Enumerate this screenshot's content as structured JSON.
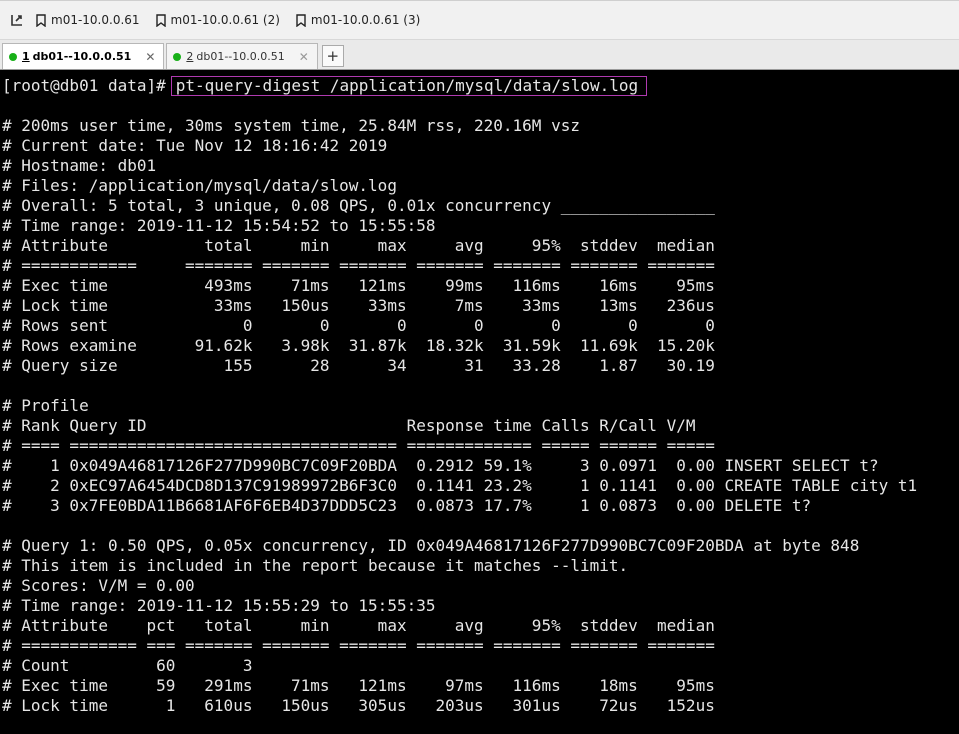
{
  "bookmarks": [
    "m01-10.0.0.61",
    "m01-10.0.0.61 (2)",
    "m01-10.0.0.61 (3)"
  ],
  "tabs": [
    {
      "num": "1",
      "label": "db01--10.0.0.51",
      "active": true
    },
    {
      "num": "2",
      "label": "db01--10.0.0.51",
      "active": false
    }
  ],
  "new_tab_label": "+",
  "terminal": {
    "prompt": "[root@db01 data]#",
    "command": "pt-query-digest /application/mysql/data/slow.log",
    "lines": [
      "",
      "# 200ms user time, 30ms system time, 25.84M rss, 220.16M vsz",
      "# Current date: Tue Nov 12 18:16:42 2019",
      "# Hostname: db01",
      "# Files: /application/mysql/data/slow.log",
      "# Overall: 5 total, 3 unique, 0.08 QPS, 0.01x concurrency ________________",
      "# Time range: 2019-11-12 15:54:52 to 15:55:58",
      "# Attribute          total     min     max     avg     95%  stddev  median",
      "# ============     ======= ======= ======= ======= ======= ======= =======",
      "# Exec time          493ms    71ms   121ms    99ms   116ms    16ms    95ms",
      "# Lock time           33ms   150us    33ms     7ms    33ms    13ms   236us",
      "# Rows sent              0       0       0       0       0       0       0",
      "# Rows examine      91.62k   3.98k  31.87k  18.32k  31.59k  11.69k  15.20k",
      "# Query size           155      28      34      31   33.28    1.87   30.19",
      "",
      "# Profile",
      "# Rank Query ID                           Response time Calls R/Call V/M",
      "# ==== ================================== ============= ===== ====== =====",
      "#    1 0x049A46817126F277D990BC7C09F20BDA  0.2912 59.1%     3 0.0971  0.00 INSERT SELECT t?",
      "#    2 0xEC97A6454DCD8D137C91989972B6F3C0  0.1141 23.2%     1 0.1141  0.00 CREATE TABLE city t1",
      "#    3 0x7FE0BDA11B6681AF6F6EB4D37DDD5C23  0.0873 17.7%     1 0.0873  0.00 DELETE t?",
      "",
      "# Query 1: 0.50 QPS, 0.05x concurrency, ID 0x049A46817126F277D990BC7C09F20BDA at byte 848",
      "# This item is included in the report because it matches --limit.",
      "# Scores: V/M = 0.00",
      "# Time range: 2019-11-12 15:55:29 to 15:55:35",
      "# Attribute    pct   total     min     max     avg     95%  stddev  median",
      "# ============ === ======= ======= ======= ======= ======= ======= =======",
      "# Count         60       3",
      "# Exec time     59   291ms    71ms   121ms    97ms   116ms    18ms    95ms",
      "# Lock time      1   610us   150us   305us   203us   301us    72us   152us"
    ]
  }
}
